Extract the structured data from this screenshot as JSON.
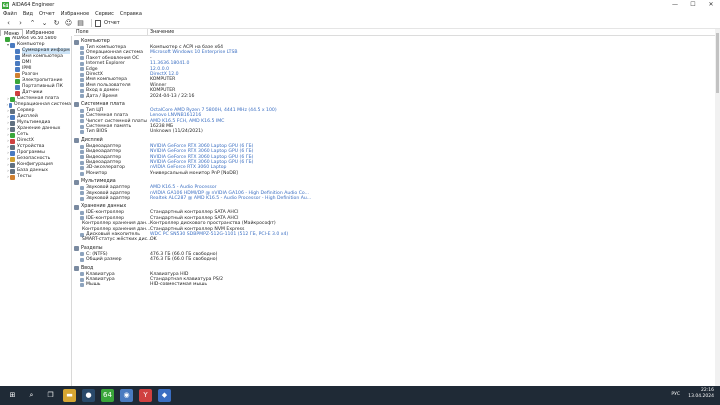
{
  "window": {
    "title": "AIDA64 Engineer",
    "controls": [
      "—",
      "☐",
      "✕"
    ]
  },
  "menu": [
    "Файл",
    "Вид",
    "Отчет",
    "Избранное",
    "Сервис",
    "Справка"
  ],
  "toolbar": {
    "report_label": "Отчет"
  },
  "tabs": [
    "Меню",
    "Избранное"
  ],
  "sidebar": [
    {
      "label": "AIDA64 v6.50.5800",
      "exp": "",
      "color": "#3aa63a",
      "indent": 0
    },
    {
      "label": "Компьютер",
      "exp": "▾",
      "color": "#4a7bc0",
      "indent": 1
    },
    {
      "label": "Суммарная информ",
      "exp": "",
      "color": "#4a7bc0",
      "indent": 2,
      "selected": true
    },
    {
      "label": "Имя компьютера",
      "exp": "",
      "color": "#4a7bc0",
      "indent": 2
    },
    {
      "label": "DMI",
      "exp": "",
      "color": "#4a7bc0",
      "indent": 2
    },
    {
      "label": "IPMI",
      "exp": "",
      "color": "#4a7bc0",
      "indent": 2
    },
    {
      "label": "Разгон",
      "exp": "",
      "color": "#d08030",
      "indent": 2
    },
    {
      "label": "Электропитание",
      "exp": "",
      "color": "#3aa63a",
      "indent": 2
    },
    {
      "label": "Портативный ПК",
      "exp": "",
      "color": "#4a7bc0",
      "indent": 2
    },
    {
      "label": "Датчики",
      "exp": "",
      "color": "#d04040",
      "indent": 2
    },
    {
      "label": "Системная плата",
      "exp": "›",
      "color": "#3aa63a",
      "indent": 1
    },
    {
      "label": "Операционная система",
      "exp": "›",
      "color": "#4a7bc0",
      "indent": 1
    },
    {
      "label": "Сервер",
      "exp": "›",
      "color": "#607080",
      "indent": 1
    },
    {
      "label": "Дисплей",
      "exp": "›",
      "color": "#4a7bc0",
      "indent": 1
    },
    {
      "label": "Мультимедиа",
      "exp": "›",
      "color": "#607080",
      "indent": 1
    },
    {
      "label": "Хранение данных",
      "exp": "›",
      "color": "#607080",
      "indent": 1
    },
    {
      "label": "Сеть",
      "exp": "›",
      "color": "#3aa63a",
      "indent": 1
    },
    {
      "label": "DirectX",
      "exp": "›",
      "color": "#d04040",
      "indent": 1
    },
    {
      "label": "Устройства",
      "exp": "›",
      "color": "#607080",
      "indent": 1
    },
    {
      "label": "Программы",
      "exp": "›",
      "color": "#4a7bc0",
      "indent": 1
    },
    {
      "label": "Безопасность",
      "exp": "›",
      "color": "#d0a030",
      "indent": 1
    },
    {
      "label": "Конфигурация",
      "exp": "›",
      "color": "#607080",
      "indent": 1
    },
    {
      "label": "База данных",
      "exp": "›",
      "color": "#607080",
      "indent": 1
    },
    {
      "label": "Тесты",
      "exp": "›",
      "color": "#d08030",
      "indent": 1
    }
  ],
  "columns": {
    "field": "Поле",
    "value": "Значение"
  },
  "sections": [
    {
      "title": "Компьютер",
      "rows": [
        {
          "f": "Тип компьютера",
          "v": "Компьютер с ACPI на базе x64"
        },
        {
          "f": "Операционная система",
          "v": "Microsoft Windows 10 Enterprise LTSB",
          "link": true
        },
        {
          "f": "Пакет обновления ОС",
          "v": "-"
        },
        {
          "f": "Internet Explorer",
          "v": "11.3636.18041.0",
          "link": true
        },
        {
          "f": "Edge",
          "v": "12.0.0.0",
          "link": true
        },
        {
          "f": "DirectX",
          "v": "DirectX 12.0",
          "link": true
        },
        {
          "f": "Имя компьютера",
          "v": "KOMPUTER"
        },
        {
          "f": "Имя пользователя",
          "v": "Winner"
        },
        {
          "f": "Вход в домен",
          "v": "KOMPUTER"
        },
        {
          "f": "Дата / Время",
          "v": "2024-04-13 / 22:16"
        }
      ]
    },
    {
      "title": "Системная плата",
      "rows": [
        {
          "f": "Тип ЦП",
          "v": "OctalCore AMD Ryzen 7 5800H, 4441 MHz (44.5 x 100)",
          "link": true
        },
        {
          "f": "Системная плата",
          "v": "Lenovo LNVNB161216",
          "link": true
        },
        {
          "f": "Чипсет системной платы",
          "v": "AMD K16.5 FCH, AMD K16.5 IMC",
          "link": true
        },
        {
          "f": "Системная память",
          "v": "16238 МБ"
        },
        {
          "f": "Тип BIOS",
          "v": "Unknown (11/24/2021)"
        }
      ]
    },
    {
      "title": "Дисплей",
      "rows": [
        {
          "f": "Видеоадаптер",
          "v": "NVIDIA GeForce RTX 3060 Laptop GPU  (6 ГБ)",
          "link": true
        },
        {
          "f": "Видеоадаптер",
          "v": "NVIDIA GeForce RTX 3060 Laptop GPU  (6 ГБ)",
          "link": true
        },
        {
          "f": "Видеоадаптер",
          "v": "NVIDIA GeForce RTX 3060 Laptop GPU  (6 ГБ)",
          "link": true
        },
        {
          "f": "Видеоадаптер",
          "v": "NVIDIA GeForce RTX 3060 Laptop GPU  (6 ГБ)",
          "link": true
        },
        {
          "f": "3D-акселератор",
          "v": "nVIDIA GeForce RTX 3060 Laptop",
          "link": true
        },
        {
          "f": "Монитор",
          "v": "Универсальный монитор PnP [NoDB]"
        }
      ]
    },
    {
      "title": "Мультимедиа",
      "rows": [
        {
          "f": "Звуковой адаптер",
          "v": "AMD K16.5 - Audio Processor",
          "link": true
        },
        {
          "f": "Звуковой адаптер",
          "v": "nVIDIA GA106 HDMI/DP @ nVIDIA GA106 - High Definition Audio Co...",
          "link": true
        },
        {
          "f": "Звуковой адаптер",
          "v": "Realtek ALC287 @ AMD K16.5 - Audio Processor - High Definition Au...",
          "link": true
        }
      ]
    },
    {
      "title": "Хранение данных",
      "rows": [
        {
          "f": "IDE-контроллер",
          "v": "Стандартный контроллер SATA AHCI"
        },
        {
          "f": "IDE-контроллер",
          "v": "Стандартный контроллер SATA AHCI"
        },
        {
          "f": "Контроллер хранения дан...",
          "v": "Контроллер дискового пространства (Майкрософт)"
        },
        {
          "f": "Контроллер хранения дан...",
          "v": "Стандартный контроллер NVM Express"
        },
        {
          "f": "Дисковый накопитель",
          "v": "WDC PC SN530 SDBPMPZ-512G-1101  (512 ГБ, PCI-E 3.0 x4)",
          "link": true
        },
        {
          "f": "SMART-статус жёстких дис...",
          "v": "OK"
        }
      ]
    },
    {
      "title": "Разделы",
      "rows": [
        {
          "f": "C: (NTFS)",
          "v": "476.3 ГБ (66.0 ГБ свободно)"
        },
        {
          "f": "Общий размер",
          "v": "476.3 ГБ (66.0 ГБ свободно)"
        }
      ]
    },
    {
      "title": "Ввод",
      "rows": [
        {
          "f": "Клавиатура",
          "v": "Клавиатура HID"
        },
        {
          "f": "Клавиатура",
          "v": "Стандартная клавиатура PS/2"
        },
        {
          "f": "Мышь",
          "v": "HID-совместимая мышь"
        }
      ]
    }
  ],
  "taskbar": {
    "apps": [
      {
        "name": "start-icon",
        "glyph": "⊞",
        "color": "#1f2a36"
      },
      {
        "name": "search-icon",
        "glyph": "⌕",
        "color": "#1f2a36"
      },
      {
        "name": "task-view-icon",
        "glyph": "❐",
        "color": "#1f2a36"
      },
      {
        "name": "explorer-icon",
        "glyph": "▬",
        "color": "#d6a632"
      },
      {
        "name": "steam-icon",
        "glyph": "●",
        "color": "#2a4a6a"
      },
      {
        "name": "aida64-icon",
        "glyph": "64",
        "color": "#3aa63a"
      },
      {
        "name": "chrome-icon",
        "glyph": "◉",
        "color": "#4a7bc0"
      },
      {
        "name": "yandex-icon",
        "glyph": "Y",
        "color": "#d04040"
      },
      {
        "name": "app-icon",
        "glyph": "◆",
        "color": "#3a6ec2"
      }
    ],
    "lang": "РУС",
    "time": "22:16",
    "date": "13.04.2024"
  }
}
